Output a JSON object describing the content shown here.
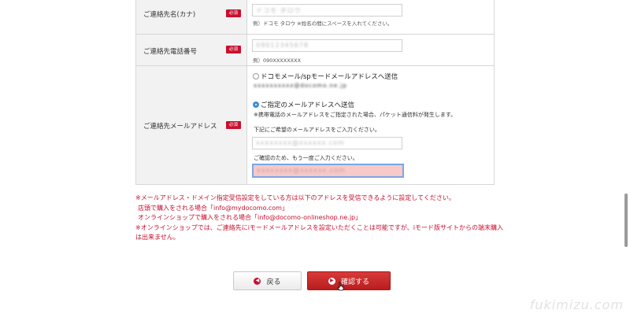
{
  "form": {
    "rows": [
      {
        "label": "ご連絡先名(カナ)",
        "badge": "必須",
        "input_value": "ドコモ タロウ",
        "hint": "例）ドコモ タロウ ※姓名の間にスペースを入れてください。"
      },
      {
        "label": "ご連絡先電話番号",
        "badge": "必須",
        "input_value": "09012345678",
        "hint": "例）090XXXXXXXX"
      },
      {
        "label": "ご連絡先メールアドレス",
        "badge": "必須",
        "option1_label": "ドコモメール/spモードメールアドレスへ送信",
        "option1_address": "xxxxxxxxxx@docomo.ne.jp",
        "option2_label": "ご指定のメールアドレスへ送信",
        "option2_note": "※携帯電話のメールアドレスをご指定された場合、パケット通信料が発生します。",
        "email_prompt": "下記にご希望のメールアドレスをご入力ください。",
        "email_value": "xxxxxxxx@xxxxxx.com",
        "confirm_prompt": "ご確認のため、もう一度ご入力ください。",
        "confirm_value": "xxxxxxxx@xxxxxx.com"
      }
    ]
  },
  "notes": {
    "line1": "※メールアドレス・ドメイン指定受信設定をしている方は以下のアドレスを受信できるように設定してください。",
    "line2": "店頭で購入をされる場合「info@mydocomo.com」",
    "line3": "オンラインショップで購入をされる場合「info@docomo-onlineshop.ne.jp」",
    "line4": "※オンラインショップでは、ご連絡先にiモードメールアドレスを設定いただくことは可能ですが、iモード版サイトからの端末購入",
    "line5": "は出来ません。"
  },
  "buttons": {
    "back_label": "戻る",
    "confirm_label": "確認する"
  },
  "watermark": "fukimizu.com",
  "colors": {
    "required_badge": "#c8102e",
    "notes_text": "#c8102e",
    "confirm_button": "#c62828",
    "radio_selected": "#3b8fd9",
    "focused_field_bg": "#f7c9c9"
  },
  "icons": {
    "back": "chevron-left-circle-icon",
    "confirm": "chevron-right-circle-icon",
    "cursor": "hand-pointer-icon"
  }
}
